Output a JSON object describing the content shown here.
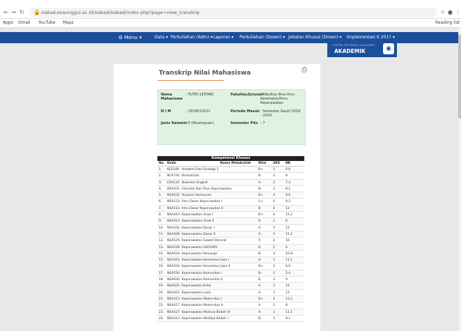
{
  "browser": {
    "url": "siakad.esaunggul.ac.id/siakad/siakad/index.php?page=view_transkrip",
    "bookmarks": [
      "Apps",
      "Gmail",
      "YouTube",
      "Maps"
    ],
    "reading_list": "Reading list"
  },
  "menu": {
    "home": "Menu",
    "items": [
      "Data",
      "Perkuliahan (Adm)",
      "Laporan",
      "Perkuliahan (Dosen)",
      "Jabatan Khusus (Dosen)",
      "Implementasi K 2017"
    ]
  },
  "logo": {
    "line1": "SISTEM INFORMASI AKADEMIK",
    "line2": "AKADEMIK"
  },
  "transcript": {
    "title": "Transkrip Nilai Mahasiswa",
    "name_label": "Nama Mahasiswa",
    "name": ": PUTRI LESTARI",
    "nim_label": "N I M",
    "nim": ": 2018031011",
    "gender_label": "Jenis Kelamin",
    "gender": ": P (Perempuan)",
    "faculty_label": "Fakultas/Jurusan",
    "faculty": ": Fakultas Ilmu-Ilmu Kesehatan/Ilmu Keperawatan",
    "period_label": "Periode Masuk",
    "period": ": Semester Ganjil 2018 - 2019",
    "semester_label": "Semester Pits",
    "semester": ": 7"
  },
  "table": {
    "section": "Kompetensi Khusus",
    "headers": [
      "No.",
      "Kode",
      "Nama Matakuliah",
      "Nilai",
      "SKS",
      "NK"
    ],
    "rows": [
      [
        "1.",
        "KES106",
        "Anatomi Dan Fisiologi 1",
        "B+",
        "2",
        "6.6"
      ],
      [
        "2.",
        "NCK742",
        "Biostatistik",
        "B",
        "3",
        "9"
      ],
      [
        "3.",
        "ESA134",
        "Business English",
        "A-",
        "2",
        "7.4"
      ],
      [
        "4.",
        "NSA101",
        "Falsafah Dan Teori Keperawatan",
        "B-",
        "3",
        "8.1"
      ],
      [
        "5.",
        "NSA632",
        "Hospice Homecare",
        "B+",
        "3",
        "9.9"
      ],
      [
        "6.",
        "NSA133",
        "Ilmu Dasar Keperawatan I",
        "C+",
        "4",
        "9.2"
      ],
      [
        "7.",
        "NSA210",
        "Ilmu Dasar Keperawatan II",
        "B",
        "4",
        "12"
      ],
      [
        "8.",
        "NSA419",
        "Keperawatan Anak I",
        "B+",
        "4",
        "13.2"
      ],
      [
        "9.",
        "NSA523",
        "Keperawatan Anak II",
        "B",
        "2",
        "6"
      ],
      [
        "10.",
        "NSA332",
        "Keperawatan Dasar I",
        "A",
        "3",
        "12"
      ],
      [
        "11.",
        "NSA208",
        "Keperawatan Dasar II",
        "A-",
        "3",
        "11.1"
      ],
      [
        "12.",
        "NSA529",
        "Keperawatan Gawat Darurat",
        "A",
        "4",
        "16"
      ],
      [
        "13.",
        "NSA528",
        "Keperawatan HIV/AIDS",
        "B",
        "2",
        "6"
      ],
      [
        "14.",
        "NSA634",
        "Keperawatan Keluarga",
        "B-",
        "4",
        "10.8"
      ],
      [
        "15.",
        "NSA425",
        "Keperawatan Kesehatan Jiwa I",
        "A-",
        "3",
        "11.1"
      ],
      [
        "16.",
        "NSA524",
        "Keperawatan Kesehatan Jiwa II",
        "B+",
        "2",
        "6.6"
      ],
      [
        "17.",
        "NSA526",
        "Keperawatan Komunitas I",
        "B-",
        "2",
        "5.4"
      ],
      [
        "18.",
        "NSA630",
        "Keperawatan Komunitas II",
        "B",
        "3",
        "9"
      ],
      [
        "19.",
        "NSA635",
        "Keperawatan Kritis",
        "A",
        "3",
        "12"
      ],
      [
        "20.",
        "NSA421",
        "Keperawatan Luka",
        "A",
        "3",
        "12"
      ],
      [
        "21.",
        "NSA313",
        "Keperawatan Maternitas I",
        "B+",
        "4",
        "13.2"
      ],
      [
        "22.",
        "NSA417",
        "Keperawatan Maternitas II",
        "A",
        "2",
        "8"
      ],
      [
        "23.",
        "NSA527",
        "Keperawatan Medical Bedah III",
        "A-",
        "3",
        "11.1"
      ],
      [
        "24.",
        "NSA312",
        "Keperawatan Medikal Bedah I",
        "B-",
        "3",
        "8.1"
      ]
    ]
  }
}
